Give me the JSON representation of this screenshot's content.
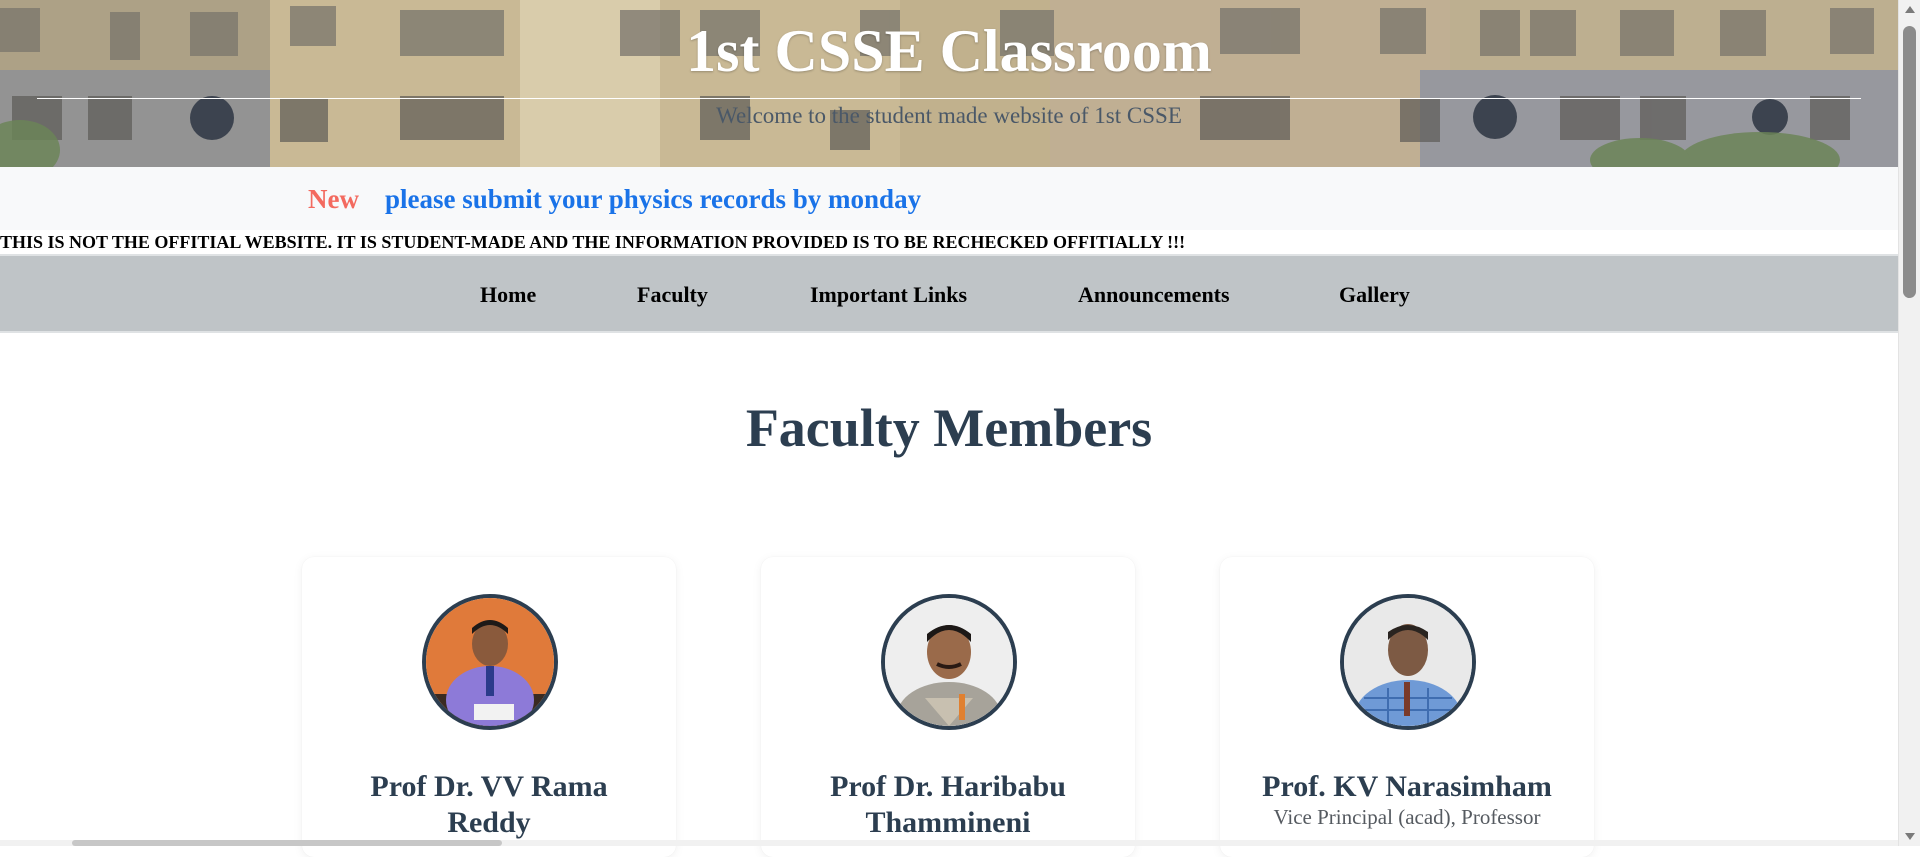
{
  "banner": {
    "title": "1st CSSE Classroom",
    "subtitle": "Welcome to the student made website of 1st CSSE"
  },
  "ticker": {
    "badge": "New",
    "message": "please submit your physics records by monday"
  },
  "disclaimer": "THIS IS NOT THE OFFITIAL WEBSITE. IT IS STUDENT-MADE AND THE INFORMATION PROVIDED IS TO BE RECHECKED OFFITIALLY !!!",
  "nav": {
    "items": [
      {
        "label": "Home"
      },
      {
        "label": "Faculty"
      },
      {
        "label": "Important Links"
      },
      {
        "label": "Announcements"
      },
      {
        "label": "Gallery"
      }
    ]
  },
  "main": {
    "title": "Faculty Members",
    "faculty": [
      {
        "name_line1": "Prof Dr. VV Rama",
        "name_line2": "Reddy",
        "role": ""
      },
      {
        "name_line1": "Prof Dr. Haribabu",
        "name_line2": "Thammineni",
        "role": ""
      },
      {
        "name_line1": "Prof. KV Narasimham",
        "name_line2": "",
        "role": "Vice Principal (acad), Professor"
      }
    ]
  },
  "colors": {
    "accent_blue": "#1a73e8",
    "new_badge": "#f36a5f",
    "heading": "#2c3e50",
    "nav_bg": "#bfc4c7"
  },
  "icons": [
    "scroll-up-arrow-icon",
    "scroll-down-arrow-icon"
  ]
}
